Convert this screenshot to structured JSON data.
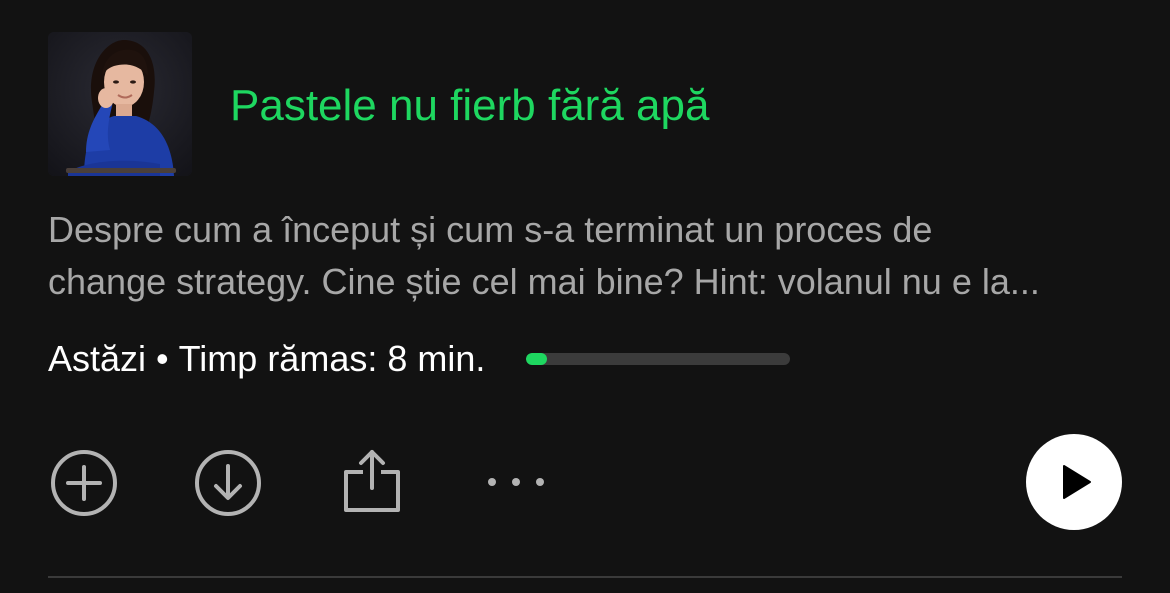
{
  "colors": {
    "accent": "#1ed760",
    "icon": "#b3b3b3",
    "background": "#121212"
  },
  "episode": {
    "title": "Pastele nu fierb fără apă",
    "description_lines": [
      "Despre cum a început și cum s-a terminat un proces de",
      "change strategy. Cine știe cel mai bine? Hint: volanul nu e la..."
    ],
    "date": "Astăzi",
    "separator": "•",
    "time_left": "Timp rămas: 8 min.",
    "progress_fraction": 0.08
  },
  "actions": {
    "add": {
      "icon": "plus-circle-icon"
    },
    "download": {
      "icon": "download-circle-icon"
    },
    "share": {
      "icon": "share-icon"
    },
    "more": {
      "icon": "more-dots-icon"
    },
    "play": {
      "icon": "play-icon"
    }
  }
}
